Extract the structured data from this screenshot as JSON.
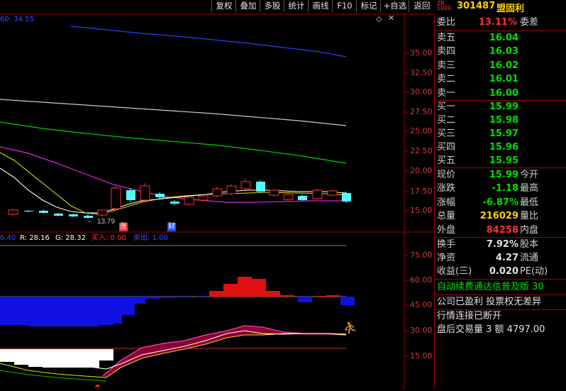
{
  "toolbar": {
    "buttons": [
      "复权",
      "叠加",
      "多股",
      "统计",
      "画线",
      "F10",
      "标记",
      "+自选",
      "返回"
    ]
  },
  "stock": {
    "zr": "ZR",
    "zr2": "1000",
    "code": "301487",
    "name": "盟固利"
  },
  "price_panel": {
    "header_left": "60: 34.55",
    "y_ticks": [
      "35.00",
      "32.50",
      "30.00",
      "27.50",
      "25.00",
      "22.50",
      "20.00",
      "17.50",
      "15.00"
    ],
    "low_marker": "13.79",
    "badge_zhang": "涨",
    "badge_cai": "财"
  },
  "indicator_panel": {
    "header": {
      "v1": "6.40",
      "r": "R: 28.16",
      "g": "G: 28.32",
      "buy": "买入: 0.00",
      "sell": "卖出: 1.00"
    },
    "y_ticks": [
      "75.00",
      "60.00",
      "45.00",
      "30.00",
      "15.00"
    ]
  },
  "quote": {
    "weibi_label": "委比",
    "weibi_val": "13.11%",
    "weicha_label": "委差",
    "asks": [
      {
        "label": "卖五",
        "price": "16.04"
      },
      {
        "label": "卖四",
        "price": "16.03"
      },
      {
        "label": "卖三",
        "price": "16.02"
      },
      {
        "label": "卖二",
        "price": "16.01"
      },
      {
        "label": "卖一",
        "price": "16.00"
      }
    ],
    "bids": [
      {
        "label": "买一",
        "price": "15.99"
      },
      {
        "label": "买二",
        "price": "15.98"
      },
      {
        "label": "买三",
        "price": "15.97"
      },
      {
        "label": "买四",
        "price": "15.96"
      },
      {
        "label": "买五",
        "price": "15.95"
      }
    ],
    "stats": [
      {
        "l": "现价",
        "v": "15.99",
        "c": "#00e000",
        "r": "今开"
      },
      {
        "l": "涨跌",
        "v": "-1.18",
        "c": "#00e000",
        "r": "最高"
      },
      {
        "l": "涨幅",
        "v": "-6.87%",
        "c": "#00e000",
        "r": "最低"
      },
      {
        "l": "总量",
        "v": "216029",
        "c": "#ffd200",
        "r": "量比"
      },
      {
        "l": "外盘",
        "v": "84258",
        "c": "#ff3030",
        "r": "内盘"
      }
    ],
    "stats2": [
      {
        "l": "换手",
        "v": "7.92%",
        "r": "股本"
      },
      {
        "l": "净资",
        "v": "4.27",
        "r": "流通"
      },
      {
        "l": "收益(三)",
        "v": "0.020",
        "r": "PE(动)"
      }
    ],
    "promo": "自动续费通达信普及版  30",
    "notice1": "公司已盈利 投票权无差异",
    "notice2": "行情连接已断开",
    "after_hours": "盘后交易量 3 额 4797.00"
  },
  "colors": {
    "up": "#ff3030",
    "down": "#54fcfc",
    "bg": "#000000",
    "grid": "#a00000"
  }
}
